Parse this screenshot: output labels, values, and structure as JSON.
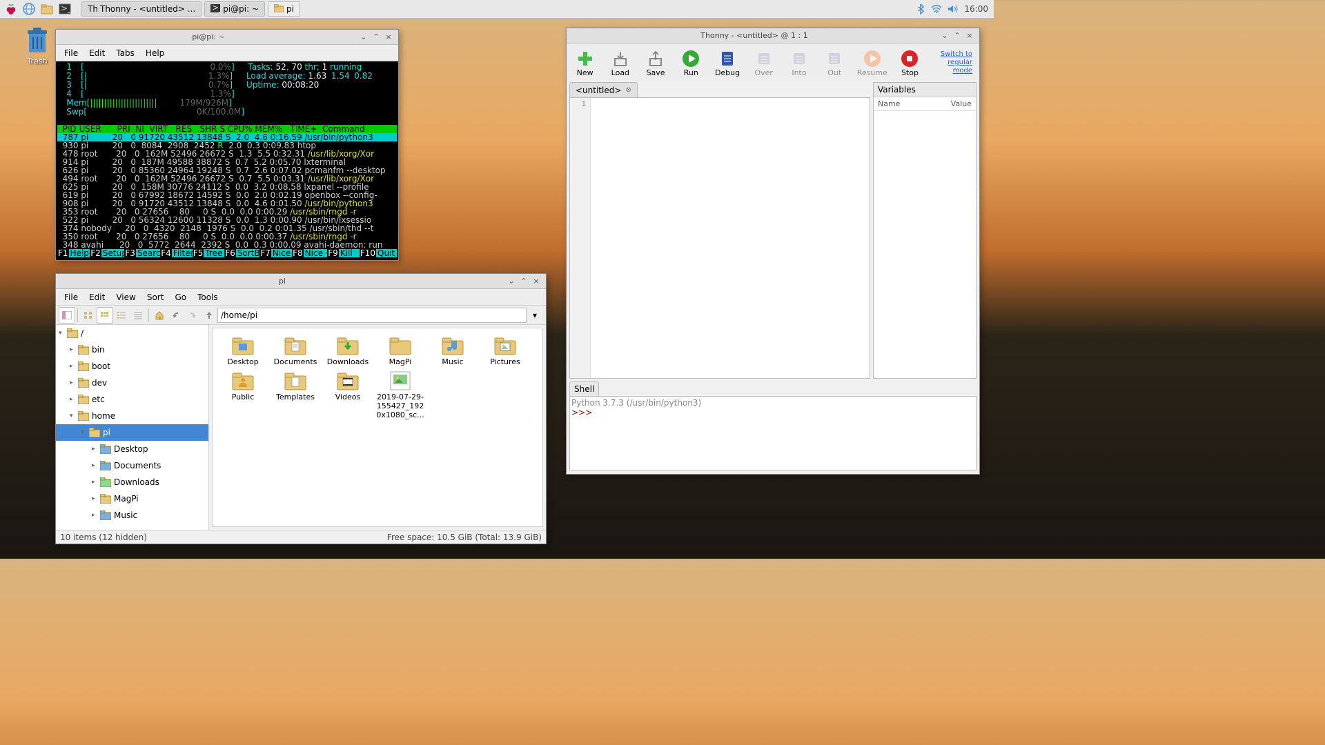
{
  "taskbar": {
    "apps": [
      {
        "label": "Thonny  -  <untitled>  ..."
      },
      {
        "label": "pi@pi: ~"
      },
      {
        "label": "pi"
      }
    ],
    "clock": "16:00"
  },
  "desktop": {
    "trash": "Trash"
  },
  "terminal": {
    "title": "pi@pi: ~",
    "menus": [
      "File",
      "Edit",
      "Tabs",
      "Help"
    ],
    "cpu_lines": [
      {
        "n": "1",
        "bar": "[",
        "pct": "0.0%",
        "close": "]"
      },
      {
        "n": "2",
        "bar": "[|",
        "pct": "1.3%",
        "close": "]"
      },
      {
        "n": "3",
        "bar": "[|",
        "pct": "0.7%",
        "close": "]"
      },
      {
        "n": "4",
        "bar": "[",
        "pct": "1.3%",
        "close": "]"
      }
    ],
    "mem": {
      "label": "Mem",
      "bar": "[||||||||||||||||||||||||",
      "val": "179M/926M",
      "close": "]"
    },
    "swp": {
      "label": "Swp",
      "bar": "[",
      "val": "0K/100.0M",
      "close": "]"
    },
    "tasks_line": "Tasks: 52, 70 thr; 1 running",
    "load_line": "Load average: 1.63 1.54 0.82",
    "uptime_line": "Uptime: 00:08:20",
    "header": "  PID USER      PRI  NI  VIRT   RES   SHR S CPU% MEM%   TIME+  Command",
    "rows": [
      {
        "sel": true,
        "pid": "787",
        "user": "pi",
        "pri": "20",
        "ni": "0",
        "virt": "91720",
        "res": "43512",
        "shr": "13848",
        "s": "S",
        "cpu": "2.0",
        "mem": "4.6",
        "time": "0:16.59",
        "cmd": "/usr/bin/python3"
      },
      {
        "pid": "930",
        "user": "pi",
        "pri": "20",
        "ni": "0",
        "virt": "8084",
        "res": "2908",
        "shr": "2452",
        "s": "R",
        "cpu": "2.0",
        "mem": "0.3",
        "time": "0:09.83",
        "cmd": "htop"
      },
      {
        "pid": "478",
        "user": "root",
        "pri": "20",
        "ni": "0",
        "virt": "162M",
        "res": "52496",
        "shr": "26672",
        "s": "S",
        "cpu": "1.3",
        "mem": "5.5",
        "time": "0:32.31",
        "cmd": "/usr/lib/xorg/Xor",
        "dim_cmd": true
      },
      {
        "pid": "914",
        "user": "pi",
        "pri": "20",
        "ni": "0",
        "virt": "187M",
        "res": "49588",
        "shr": "38872",
        "s": "S",
        "cpu": "0.7",
        "mem": "5.2",
        "time": "0:05.70",
        "cmd": "lxterminal"
      },
      {
        "pid": "626",
        "user": "pi",
        "pri": "20",
        "ni": "0",
        "virt": "85360",
        "res": "24964",
        "shr": "19248",
        "s": "S",
        "cpu": "0.7",
        "mem": "2.6",
        "time": "0:07.02",
        "cmd": "pcmanfm --desktop"
      },
      {
        "pid": "494",
        "user": "root",
        "pri": "20",
        "ni": "0",
        "virt": "162M",
        "res": "52496",
        "shr": "26672",
        "s": "S",
        "cpu": "0.7",
        "mem": "5.5",
        "time": "0:03.31",
        "cmd": "/usr/lib/xorg/Xor",
        "dim_cmd": true
      },
      {
        "pid": "625",
        "user": "pi",
        "pri": "20",
        "ni": "0",
        "virt": "158M",
        "res": "30776",
        "shr": "24112",
        "s": "S",
        "cpu": "0.0",
        "mem": "3.2",
        "time": "0:08.58",
        "cmd": "lxpanel --profile"
      },
      {
        "pid": "619",
        "user": "pi",
        "pri": "20",
        "ni": "0",
        "virt": "67992",
        "res": "18672",
        "shr": "14592",
        "s": "S",
        "cpu": "0.0",
        "mem": "2.0",
        "time": "0:02.19",
        "cmd": "openbox --config-"
      },
      {
        "pid": "908",
        "user": "pi",
        "pri": "20",
        "ni": "0",
        "virt": "91720",
        "res": "43512",
        "shr": "13848",
        "s": "S",
        "cpu": "0.0",
        "mem": "4.6",
        "time": "0:01.50",
        "cmd": "/usr/bin/python3",
        "dim_cmd": true
      },
      {
        "pid": "353",
        "user": "root",
        "pri": "20",
        "ni": "0",
        "virt": "27656",
        "res": "80",
        "shr": "0",
        "s": "S",
        "cpu": "0.0",
        "mem": "0.0",
        "time": "0:00.29",
        "cmd": "/usr/sbin/rngd -r",
        "dim_cmd": true
      },
      {
        "pid": "522",
        "user": "pi",
        "pri": "20",
        "ni": "0",
        "virt": "56324",
        "res": "12600",
        "shr": "11328",
        "s": "S",
        "cpu": "0.0",
        "mem": "1.3",
        "time": "0:00.90",
        "cmd": "/usr/bin/lxsessio"
      },
      {
        "pid": "374",
        "user": "nobody",
        "pri": "20",
        "ni": "0",
        "virt": "4320",
        "res": "2148",
        "shr": "1976",
        "s": "S",
        "cpu": "0.0",
        "mem": "0.2",
        "time": "0:01.35",
        "cmd": "/usr/sbin/thd --t"
      },
      {
        "pid": "350",
        "user": "root",
        "pri": "20",
        "ni": "0",
        "virt": "27656",
        "res": "80",
        "shr": "0",
        "s": "S",
        "cpu": "0.0",
        "mem": "0.0",
        "time": "0:00.37",
        "cmd": "/usr/sbin/rngd -r",
        "dim_cmd": true
      },
      {
        "pid": "348",
        "user": "avahi",
        "pri": "20",
        "ni": "0",
        "virt": "5772",
        "res": "2644",
        "shr": "2392",
        "s": "S",
        "cpu": "0.0",
        "mem": "0.3",
        "time": "0:00.09",
        "cmd": "avahi-daemon: run"
      }
    ],
    "fkeys": [
      {
        "k": "F1",
        "l": "Help"
      },
      {
        "k": "F2",
        "l": "Setup"
      },
      {
        "k": "F3",
        "l": "Search"
      },
      {
        "k": "F4",
        "l": "Filter"
      },
      {
        "k": "F5",
        "l": "Tree"
      },
      {
        "k": "F6",
        "l": "SortBy"
      },
      {
        "k": "F7",
        "l": "Nice -"
      },
      {
        "k": "F8",
        "l": "Nice +"
      },
      {
        "k": "F9",
        "l": "Kill"
      },
      {
        "k": "F10",
        "l": "Quit"
      }
    ]
  },
  "fm": {
    "title": "pi",
    "menus": [
      "File",
      "Edit",
      "View",
      "Sort",
      "Go",
      "Tools"
    ],
    "path": "/home/pi",
    "tree": [
      {
        "name": "/",
        "depth": 0,
        "exp": "▾"
      },
      {
        "name": "bin",
        "depth": 1,
        "exp": "▸"
      },
      {
        "name": "boot",
        "depth": 1,
        "exp": "▸"
      },
      {
        "name": "dev",
        "depth": 1,
        "exp": "▸"
      },
      {
        "name": "etc",
        "depth": 1,
        "exp": "▸"
      },
      {
        "name": "home",
        "depth": 1,
        "exp": "▾"
      },
      {
        "name": "pi",
        "depth": 2,
        "exp": "▾",
        "sel": true,
        "home": true
      },
      {
        "name": "Desktop",
        "depth": 3,
        "exp": "▸",
        "blue": true
      },
      {
        "name": "Documents",
        "depth": 3,
        "exp": "▸",
        "blue": true
      },
      {
        "name": "Downloads",
        "depth": 3,
        "exp": "▸",
        "green": true
      },
      {
        "name": "MagPi",
        "depth": 3,
        "exp": "▸"
      },
      {
        "name": "Music",
        "depth": 3,
        "exp": "▸",
        "blue": true
      }
    ],
    "icons": [
      {
        "name": "Desktop",
        "t": "folder-blue"
      },
      {
        "name": "Documents",
        "t": "folder-doc"
      },
      {
        "name": "Downloads",
        "t": "folder-dl"
      },
      {
        "name": "MagPi",
        "t": "folder"
      },
      {
        "name": "Music",
        "t": "folder-music"
      },
      {
        "name": "Pictures",
        "t": "folder-pic"
      },
      {
        "name": "Public",
        "t": "folder-pub"
      },
      {
        "name": "Templates",
        "t": "folder-tpl"
      },
      {
        "name": "Videos",
        "t": "folder-vid"
      },
      {
        "name": "2019-07-29-155427_1920x1080_sc...",
        "t": "image"
      }
    ],
    "status_left": "10 items (12 hidden)",
    "status_right": "Free space: 10.5 GiB (Total: 13.9 GiB)"
  },
  "thonny": {
    "title": "Thonny  -  <untitled>  @  1 : 1",
    "tools": [
      {
        "l": "New",
        "c": "#4b4"
      },
      {
        "l": "Load",
        "c": "#888"
      },
      {
        "l": "Save",
        "c": "#888"
      },
      {
        "l": "Run",
        "c": "#3a3"
      },
      {
        "l": "Debug",
        "c": "#35a"
      },
      {
        "l": "Over",
        "c": "#aac",
        "d": true
      },
      {
        "l": "Into",
        "c": "#aac",
        "d": true
      },
      {
        "l": "Out",
        "c": "#aac",
        "d": true
      },
      {
        "l": "Resume",
        "c": "#f84",
        "d": true
      },
      {
        "l": "Stop",
        "c": "#d22"
      }
    ],
    "link": "Switch to\nregular mode",
    "tab": "<untitled>",
    "gutter_line": "1",
    "vars_title": "Variables",
    "vars_cols": [
      "Name",
      "Value"
    ],
    "shell_title": "Shell",
    "shell_line": "Python 3.7.3 (/usr/bin/python3)",
    "shell_prompt": ">>>"
  }
}
